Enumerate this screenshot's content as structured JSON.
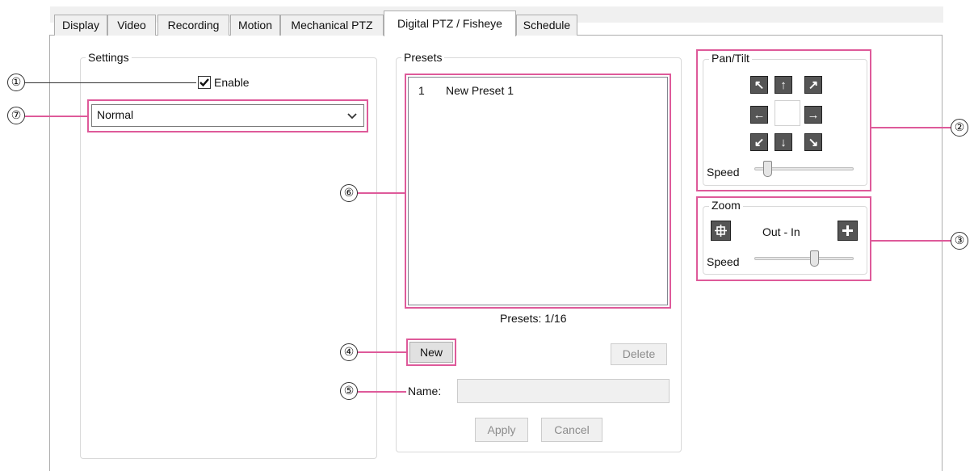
{
  "tabs": [
    "Display",
    "Video",
    "Recording",
    "Motion",
    "Mechanical PTZ",
    "Digital PTZ / Fisheye",
    "Schedule"
  ],
  "settings": {
    "legend": "Settings",
    "enable_label": "Enable",
    "enable_checked": true,
    "mode_value": "Normal"
  },
  "presets": {
    "legend": "Presets",
    "items": [
      {
        "index": "1",
        "name": "New Preset 1"
      }
    ],
    "count_text": "Presets:  1/16",
    "new_label": "New",
    "delete_label": "Delete",
    "name_label": "Name:",
    "name_value": "",
    "apply_label": "Apply",
    "cancel_label": "Cancel"
  },
  "pantilt": {
    "legend": "Pan/Tilt",
    "speed_label": "Speed",
    "speed_value": 0.1
  },
  "zoom": {
    "legend": "Zoom",
    "range_label": "Out - In",
    "speed_label": "Speed",
    "speed_value": 0.62
  },
  "callouts": [
    "①",
    "②",
    "③",
    "④",
    "⑤",
    "⑥",
    "⑦"
  ],
  "colors": {
    "highlight": "#de5a9a",
    "icon_bg": "#555555"
  }
}
